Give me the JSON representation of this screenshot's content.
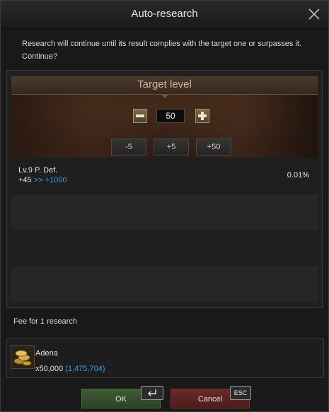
{
  "dialog": {
    "title": "Auto-research",
    "close_icon": "close-icon",
    "message": "Research will continue until its result complies with the target one or surpasses it. Continue?"
  },
  "target": {
    "title": "Target level",
    "value": "50",
    "minus_icon": "minus-icon",
    "plus_icon": "plus-icon",
    "quick_buttons": [
      "-5",
      "+5",
      "+50"
    ]
  },
  "research_list": [
    {
      "name": "Lv.9 P. Def.",
      "current": "+45",
      "arrow": ">>",
      "target": "+1000",
      "chance": "0.01%"
    }
  ],
  "fee": {
    "label": "Fee for 1 research",
    "item_name": "Adena",
    "item_icon": "adena-coins-icon",
    "amount": "x50,000",
    "owned": "(1,475,704)"
  },
  "buttons": {
    "ok_label": "OK",
    "ok_key_icon": "enter-key-icon",
    "cancel_label": "Cancel",
    "cancel_key": "ESC"
  },
  "colors": {
    "accent_blue": "#3d9be0",
    "ok_green": "#3f5a34",
    "cancel_red": "#6a2a28"
  }
}
